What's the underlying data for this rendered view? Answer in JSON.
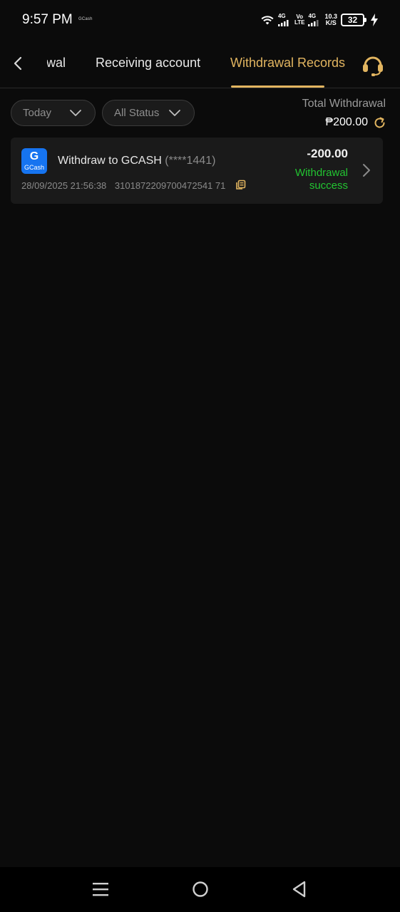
{
  "status_bar": {
    "time": "9:57 PM",
    "notification": "GCash",
    "net1": "4G",
    "volte_top": "Vo",
    "volte_bottom": "LTE",
    "net2": "4G",
    "speed_value": "10.3",
    "speed_unit": "K/S",
    "battery": "32"
  },
  "tabs": {
    "partial": "Withdrawal",
    "receiving": "Receiving account",
    "records": "Withdrawal Records",
    "active_color": "#e2b560"
  },
  "filters": {
    "date": "Today",
    "status": "All Status"
  },
  "summary": {
    "label": "Total Withdrawal",
    "amount": "₱200.00"
  },
  "records": [
    {
      "title": "Withdraw to GCASH",
      "account": "(****1441)",
      "datetime": "28/09/2025 21:56:38",
      "order_no": "3101872209700472541 71",
      "amount": "-200.00",
      "status": "Withdrawal success",
      "status_color": "#22c431",
      "logo_glyph": "G",
      "logo_text": "GCash"
    }
  ],
  "icons": {
    "back": "chevron-left-icon",
    "support": "headset-icon",
    "refresh": "refresh-icon",
    "copy": "copy-icon",
    "nav": [
      "menu-icon",
      "home-icon",
      "back-triangle-icon"
    ]
  }
}
